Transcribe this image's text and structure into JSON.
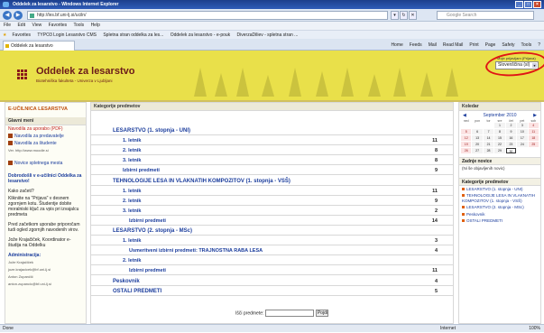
{
  "window": {
    "title": "Oddelek za lesarstvo - Windows Internet Explorer"
  },
  "address": {
    "url": "http://les.bf.uni-lj.si/uciln/",
    "search_placeholder": "Google Search"
  },
  "menu": [
    "File",
    "Edit",
    "View",
    "Favorites",
    "Tools",
    "Help"
  ],
  "favorites": {
    "label": "Favorites",
    "items": [
      "TYPO3 Login Lesarstvo CMS",
      "Spletna stran oddelka za les...",
      "Oddelek za lesarstvo - e-pouk",
      "DiverzaDiliev - spletna stran ..."
    ]
  },
  "tab": {
    "label": "Oddelek za lesarstvo"
  },
  "toolbar": {
    "home": "Home",
    "feeds": "Feeds",
    "mail": "Mail",
    "read_mail": "Read Mail",
    "print": "Print",
    "page": "Page",
    "safety": "Safety",
    "tools": "Tools",
    "help": "?"
  },
  "banner": {
    "title": "Oddelek za lesarstvo",
    "subtitle": "Biotehniška fakulteta - Univerza v Ljubljani",
    "lang_label": "Moje prijavljam (Prijava)",
    "lang_value": "Slovenščina (sl)"
  },
  "left": {
    "brand": "E-UČILNICA LESARSTVA",
    "main_menu": "Glavni meni",
    "manual": "Navodila za uporabo (PDF)",
    "for_teachers": "Navodila za predavatelje",
    "for_students": "Navodila za študente",
    "moodle": "Ver. http://www.moodle.si",
    "news": "Novice spletnega mesta",
    "welcome": "Dobrodošli v e-učilnici Oddelka za lesarstvo!",
    "how_start": "Kako začeti?",
    "how_text": "Klikniite na \"Prijava\" v desnem zgornjem kotu. Študentje dobite moralniski ključ za vpis pri izvajalcu predmeta",
    "before_text": "Pred začetkom uporabe priporočam tudi ogled zgornjih navodenih virov.",
    "coord": "Jože Krajačiček, Koordinator e-študija na Oddelku",
    "admin_title": "Administracija:",
    "admin_lines": [
      "Jože Krajačiček",
      "joze.krajacicek@bf.uni-lj.si",
      "Anton Zupančič",
      "anton.zupancic@bf.uni-lj.si"
    ]
  },
  "main": {
    "header": "Kategorije predmetov",
    "categories": [
      {
        "label": "LESARSTVO (1. stopnja - UNI)",
        "count": "",
        "level": 0
      },
      {
        "label": "1. letnik",
        "count": "11",
        "level": 1
      },
      {
        "label": "2. letnik",
        "count": "8",
        "level": 1
      },
      {
        "label": "3. letnik",
        "count": "8",
        "level": 1
      },
      {
        "label": "Izbirni predmeti",
        "count": "9",
        "level": 1
      },
      {
        "label": "TEHNOLOGIJE LESA IN VLAKNATIH KOMPOZITOV (1. stopnja - VSŠ)",
        "count": "",
        "level": 0
      },
      {
        "label": "1. letnik",
        "count": "11",
        "level": 1
      },
      {
        "label": "2. letnik",
        "count": "9",
        "level": 1
      },
      {
        "label": "3. letnik",
        "count": "2",
        "level": 1
      },
      {
        "label": "Izbirni predmeti",
        "count": "14",
        "level": 2
      },
      {
        "label": "LESARSTVO (2. stopnja - MSc)",
        "count": "",
        "level": 0
      },
      {
        "label": "1. letnik",
        "count": "3",
        "level": 1
      },
      {
        "label": "Usmeritveni izbirni predmeti: TRAJNOSTNA RABA LESA",
        "count": "4",
        "level": 2
      },
      {
        "label": "2. letnik",
        "count": "",
        "level": 1
      },
      {
        "label": "Izbirni predmeti",
        "count": "11",
        "level": 2
      },
      {
        "label": "Peskovnik",
        "count": "4",
        "level": 0
      },
      {
        "label": "OSTALI PREDMETI",
        "count": "5",
        "level": 0
      }
    ],
    "search_label": "Išči predmete:",
    "search_button": "Pojdi"
  },
  "right": {
    "calendar_title": "Koledar",
    "month": "September 2010",
    "weekdays": [
      "ned",
      "pon",
      "tor",
      "sre",
      "čet",
      "pet",
      "sob"
    ],
    "days": [
      "",
      "",
      "",
      "1",
      "2",
      "3",
      "4",
      "5",
      "6",
      "7",
      "8",
      "9",
      "10",
      "11",
      "12",
      "13",
      "14",
      "15",
      "16",
      "17",
      "18",
      "19",
      "20",
      "21",
      "22",
      "23",
      "24",
      "25",
      "26",
      "27",
      "28",
      "29",
      "30",
      "",
      ""
    ],
    "news_title": "Zadnje novice",
    "news_text": "(Ni še objavljenih novic)",
    "cat_title": "Kategorije predmetov",
    "cats": [
      "LESARSTVO (1. stopnja - UNI)",
      "TEHNOLOGIJE LESA IN VLAKNATIH KOMPOZITOV (1. stopnja - VSŠ)",
      "LESARSTVO (2. stopnja - MSc)",
      "Peskovnik",
      "OSTALI PREDMETI"
    ]
  },
  "status": {
    "left": "Done",
    "zone": "Internet",
    "zoom": "100%"
  }
}
